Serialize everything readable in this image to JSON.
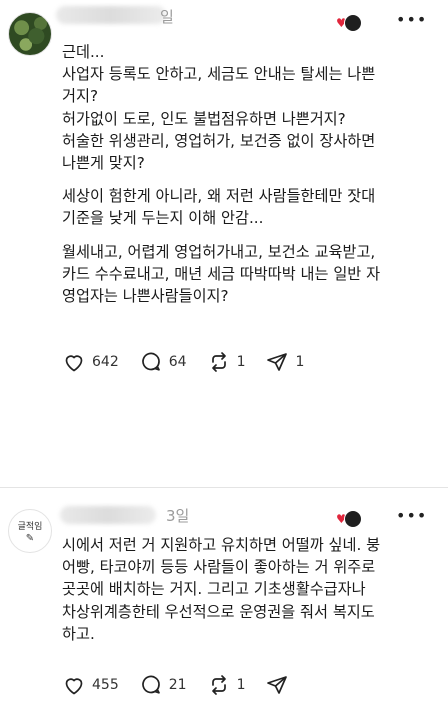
{
  "posts": [
    {
      "time": "일",
      "paragraphs": [
        [
          "근데...",
          "사업자 등록도 안하고, 세금도 안내는 탈세는 나쁜",
          "거지?",
          "허가없이 도로, 인도 불법점유하면 나쁜거지?",
          "허술한 위생관리, 영업허가, 보건증 없이 장사하면",
          "나쁜게 맞지?"
        ],
        [
          "세상이 험한게 아니라, 왜 저런 사람들한테만 잣대",
          "기준을 낮게 두는지 이해 안감..."
        ],
        [
          "월세내고, 어렵게 영업허가내고, 보건소 교육받고,",
          "카드 수수료내고, 매년 세금 따박따박 내는 일반 자",
          "영업자는 나쁜사람들이지?"
        ]
      ],
      "likes": "642",
      "comments": "64",
      "reposts": "1",
      "shares": "1"
    },
    {
      "time": "3일",
      "avatar_text": "글적임",
      "paragraphs": [
        [
          "시에서 저런 거 지원하고 유치하면 어떨까 싶네. 붕",
          "어빵, 타코야끼 등등 사람들이 좋아하는 거 위주로",
          "곳곳에 배치하는 거지. 그리고 기초생활수급자나",
          "차상위계층한테 우선적으로 운영권을 줘서 복지도",
          "하고."
        ]
      ],
      "likes": "455",
      "comments": "21",
      "reposts": "1",
      "shares": ""
    }
  ],
  "icons": {
    "more": "more-icon",
    "like": "heart-icon",
    "comment": "comment-icon",
    "repost": "repost-icon",
    "share": "share-icon"
  },
  "colors": {
    "heart_badge": "#e0263c",
    "time_text": "#9b9b9b",
    "divider": "#e4e4e4"
  }
}
